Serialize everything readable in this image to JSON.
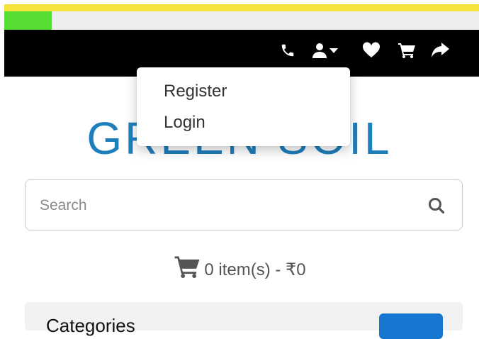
{
  "progress": {
    "value": 0.1
  },
  "navbar": {
    "icons": [
      "phone-icon",
      "user-icon",
      "chevron-down-icon",
      "heart-icon",
      "cart-icon",
      "share-icon"
    ]
  },
  "account_menu": {
    "items": [
      {
        "label": "Register"
      },
      {
        "label": "Login"
      }
    ]
  },
  "logo": {
    "text": "GREEN SOIL"
  },
  "search": {
    "placeholder": "Search"
  },
  "cart": {
    "summary": "0 item(s) - ₹0"
  },
  "categories": {
    "label": "Categories"
  },
  "colors": {
    "topbar": "#f5e23a",
    "progress_fill": "#55dd33",
    "navbar": "#000000",
    "logo": "#1f7fbd",
    "button": "#1577d0"
  }
}
